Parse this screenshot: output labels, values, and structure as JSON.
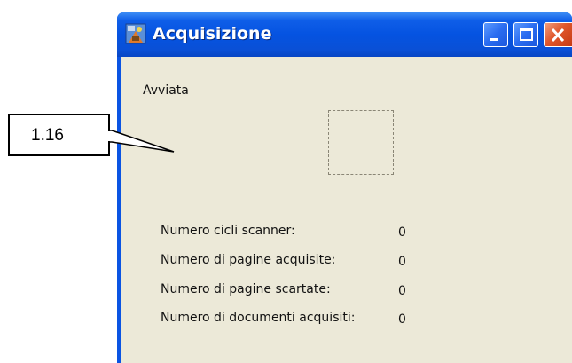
{
  "window": {
    "title": "Acquisizione",
    "icon": "scanner-app-icon",
    "controls": [
      "minimize-icon",
      "maximize-icon",
      "close-icon"
    ],
    "colors": {
      "titlebar": "#0553e1",
      "client_bg": "#ece9d8",
      "close_button": "#e0572c"
    }
  },
  "status": {
    "label": "Avviata"
  },
  "stats": [
    {
      "label": "Numero cicli scanner:",
      "value": "0"
    },
    {
      "label": "Numero di pagine acquisite:",
      "value": "0"
    },
    {
      "label": "Numero di pagine scartate:",
      "value": "0"
    },
    {
      "label": "Numero di documenti acquisiti:",
      "value": "0"
    }
  ],
  "callout": {
    "text": "1.16"
  }
}
